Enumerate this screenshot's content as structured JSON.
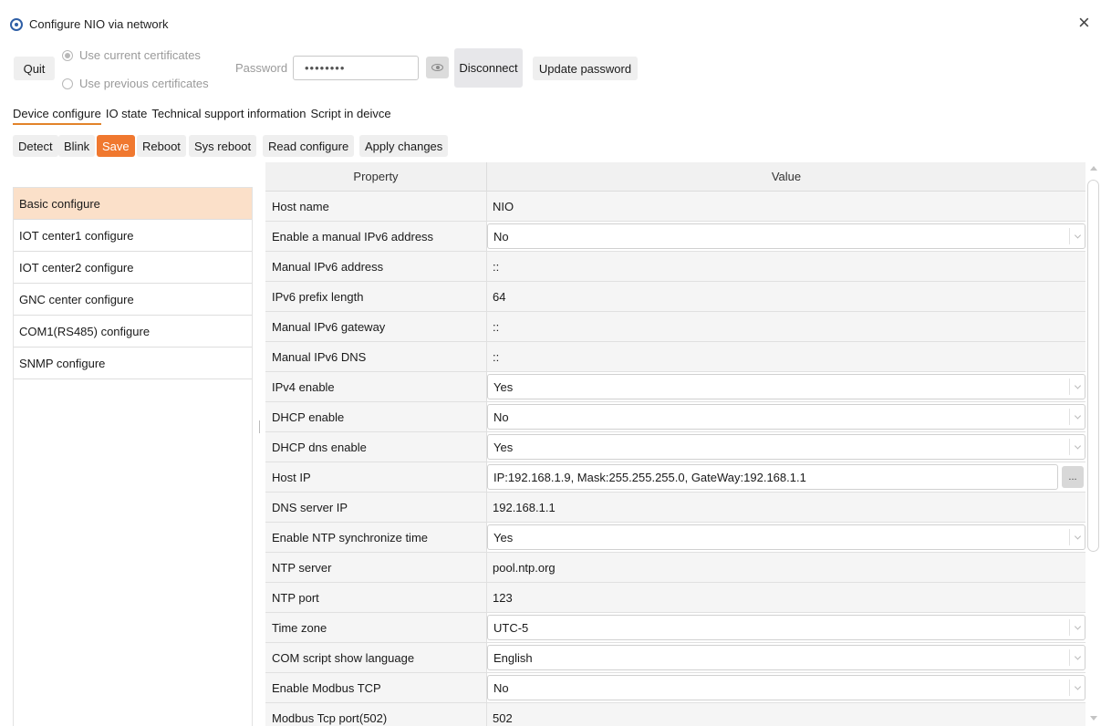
{
  "window": {
    "title": "Configure NIO via network",
    "app_icon": "gear-icon",
    "close_icon": "close-icon",
    "close_glyph": "×"
  },
  "toolbar": {
    "quit_label": "Quit",
    "cert_options": [
      {
        "label": "Use current certificates",
        "checked": true
      },
      {
        "label": "Use previous certificates",
        "checked": false
      }
    ],
    "password_label": "Password",
    "password_value": "••••••••",
    "eye_icon": "eye-icon",
    "disconnect_label": "Disconnect",
    "update_password_label": "Update password"
  },
  "tabs": [
    {
      "label": "Device configure",
      "active": true
    },
    {
      "label": "IO state",
      "active": false
    },
    {
      "label": "Technical support information",
      "active": false
    },
    {
      "label": "Script in deivce",
      "active": false
    }
  ],
  "actions": {
    "detect": "Detect",
    "blink": "Blink",
    "save": "Save",
    "reboot": "Reboot",
    "sys_reboot": "Sys reboot",
    "read_configure": "Read configure",
    "apply_changes": "Apply changes"
  },
  "nav": [
    {
      "label": "Basic configure",
      "active": true
    },
    {
      "label": "IOT center1 configure",
      "active": false
    },
    {
      "label": "IOT center2 configure",
      "active": false
    },
    {
      "label": "GNC center configure",
      "active": false
    },
    {
      "label": "COM1(RS485) configure",
      "active": false
    },
    {
      "label": "SNMP configure",
      "active": false
    }
  ],
  "grid": {
    "header_property": "Property",
    "header_value": "Value",
    "rows": [
      {
        "property": "Host name",
        "value": "NIO",
        "kind": "text"
      },
      {
        "property": "Enable a manual IPv6 address",
        "value": "No",
        "kind": "combo"
      },
      {
        "property": "Manual IPv6 address",
        "value": "::",
        "kind": "text"
      },
      {
        "property": "IPv6 prefix length",
        "value": "64",
        "kind": "text"
      },
      {
        "property": "Manual IPv6 gateway",
        "value": "::",
        "kind": "text"
      },
      {
        "property": "Manual IPv6 DNS",
        "value": "::",
        "kind": "text"
      },
      {
        "property": "IPv4 enable",
        "value": "Yes",
        "kind": "combo"
      },
      {
        "property": "DHCP enable",
        "value": "No",
        "kind": "combo"
      },
      {
        "property": "DHCP dns enable",
        "value": "Yes",
        "kind": "combo"
      },
      {
        "property": "Host IP",
        "value": "IP:192.168.1.9, Mask:255.255.255.0, GateWay:192.168.1.1",
        "kind": "dialog",
        "button": "..."
      },
      {
        "property": "DNS server IP",
        "value": "192.168.1.1",
        "kind": "text"
      },
      {
        "property": "Enable NTP synchronize time",
        "value": "Yes",
        "kind": "combo"
      },
      {
        "property": "NTP server",
        "value": "pool.ntp.org",
        "kind": "text"
      },
      {
        "property": "NTP port",
        "value": "123",
        "kind": "text"
      },
      {
        "property": "Time zone",
        "value": "UTC-5",
        "kind": "combo"
      },
      {
        "property": "COM script show language",
        "value": "English",
        "kind": "combo"
      },
      {
        "property": "Enable Modbus TCP",
        "value": "No",
        "kind": "combo"
      },
      {
        "property": "Modbus Tcp port(502)",
        "value": "502",
        "kind": "text"
      }
    ]
  },
  "colors": {
    "accent": "#f0782f",
    "nav_active": "#fbe0c9",
    "tab_underline": "#e2832a"
  }
}
